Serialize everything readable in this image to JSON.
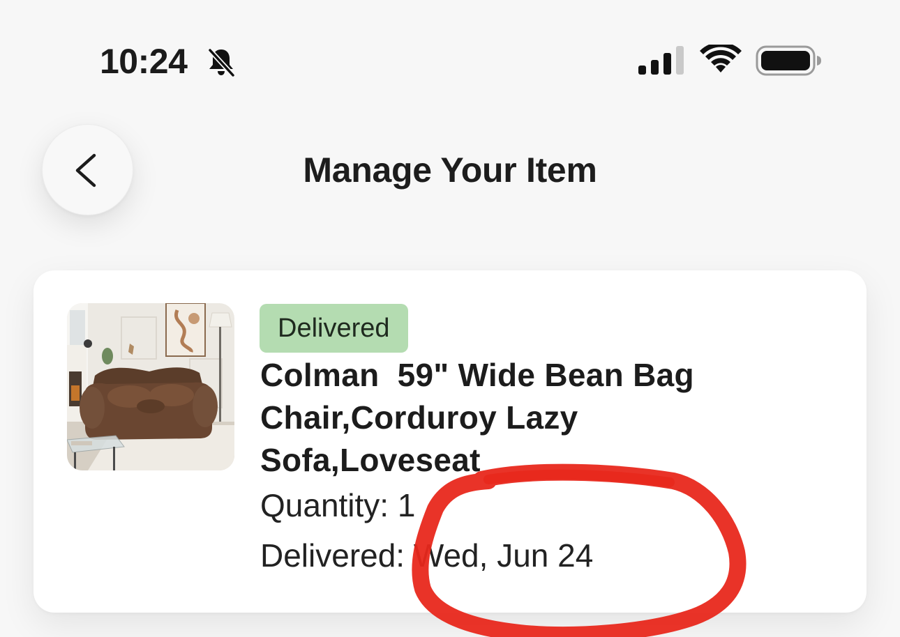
{
  "status_bar": {
    "time": "10:24",
    "icons": [
      "bell-slash-icon",
      "cellular-signal-icon",
      "wifi-icon",
      "battery-icon"
    ]
  },
  "header": {
    "title": "Manage Your Item",
    "back_icon": "chevron-left-icon"
  },
  "item": {
    "status_badge": "Delivered",
    "title": "Colman  59\" Wide Bean Bag Chair,Corduroy Lazy Sofa,Loveseat",
    "quantity_label": "Quantity:",
    "quantity_value": "1",
    "delivered_label": "Delivered:",
    "delivered_date": "Wed, Jun 24",
    "image": "bean-bag-sofa-photo"
  },
  "colors": {
    "background": "#f7f7f7",
    "card": "#ffffff",
    "badge_bg": "#b4dcb1",
    "annotation": "#e8281c"
  }
}
